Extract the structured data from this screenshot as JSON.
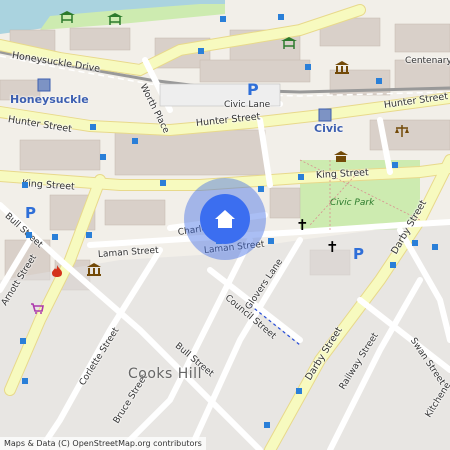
{
  "map": {
    "attribution": "Maps & Data (C) OpenStreetMap.org contributors",
    "colors": {
      "land": "#f2efe9",
      "road_secondary": "#f7fabf",
      "road_residential": "#ffffff",
      "park": "#cdebb0",
      "water": "#aad3df",
      "rail": "#999999",
      "marker": "#3b6ef0",
      "parking": "#2f6fd8"
    },
    "streets": {
      "honeysuckle_drive": "Honeysuckle Drive",
      "hunter_street_w": "Hunter Street",
      "hunter_street_mid": "Hunter Street",
      "hunter_street_e": "Hunter Street",
      "king_street_w": "King Street",
      "king_street_e": "King Street",
      "civic_lane": "Civic Lane",
      "worth_place": "Worth Place",
      "centenary": "Centenary",
      "charles_street": "Charles Street",
      "laman_street_w": "Laman Street",
      "laman_street_e": "Laman Street",
      "bull_street_nw": "Bull Street",
      "bull_street": "Bull Street",
      "arnott_street": "Arnott Street",
      "corlette_street": "Corlette Street",
      "bruce_street": "Bruce Street",
      "council_street": "Council Street",
      "glovers_lane": "Glovers Lane",
      "darby_street_n": "Darby Street",
      "darby_street_s": "Darby Street",
      "railway_street": "Railway Street",
      "swan_street": "Swan Street",
      "kitchener": "Kitchene"
    },
    "places": {
      "honeysuckle": "Honeysuckle",
      "civic": "Civic",
      "civic_park": "Civic Park",
      "cooks_hill": "Cooks Hill"
    },
    "icons": [
      "home-icon",
      "parking-icon",
      "museum-icon",
      "court-icon",
      "church-icon",
      "theatre-icon",
      "fire-station-icon",
      "shop-icon",
      "railway-station-icon",
      "bus-stop-icon"
    ]
  }
}
